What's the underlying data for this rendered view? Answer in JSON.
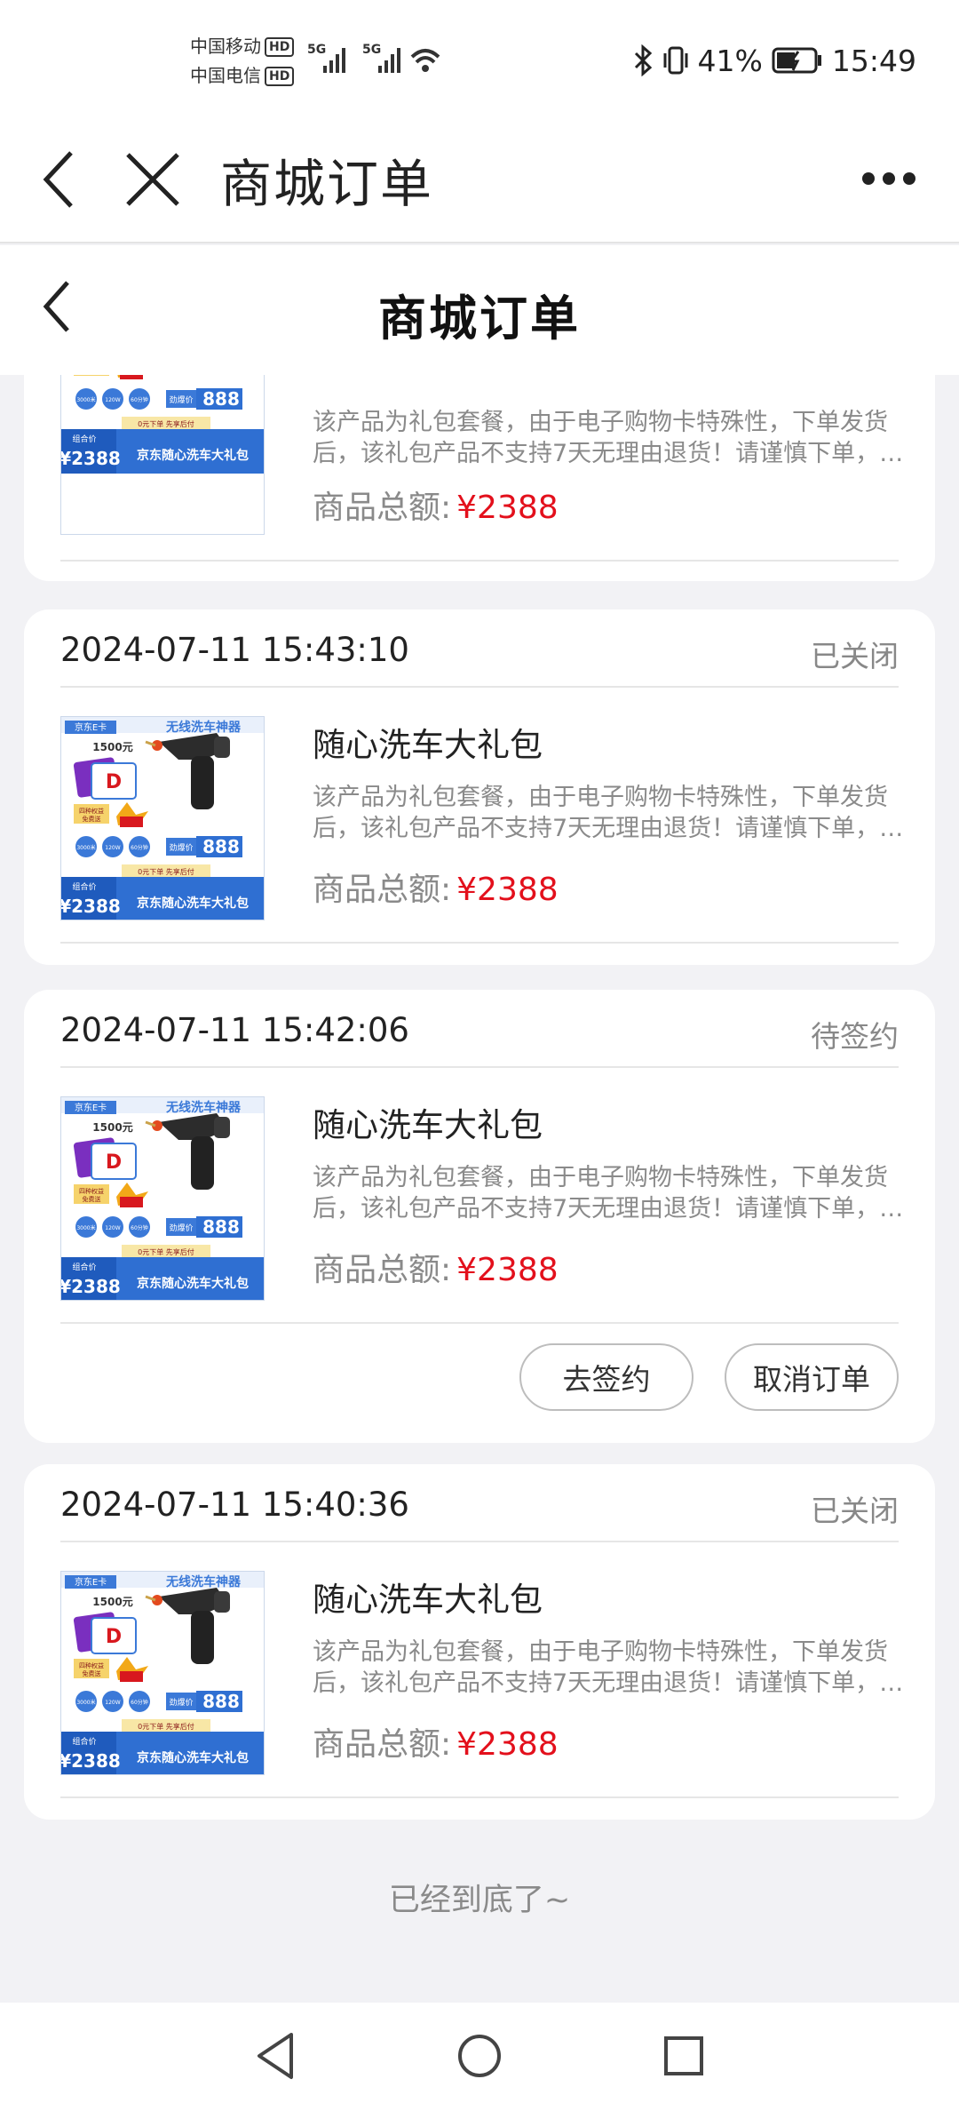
{
  "status_bar": {
    "carrier1": "中国移动",
    "carrier2": "中国电信",
    "hd": "HD",
    "net1": "5G",
    "net2": "5G",
    "battery": "41%",
    "time": "15:49"
  },
  "web_header": {
    "title": "商城订单",
    "back_icon": "chevron-left-icon",
    "close_icon": "close-icon",
    "more_icon": "more-dots-icon"
  },
  "page_header": {
    "title": "商城订单",
    "back_icon": "chevron-left-icon"
  },
  "thumbnail": {
    "top_left_label": "京东E卡",
    "top_right_label": "无线洗车神器",
    "amount": "1500元",
    "badge_left": "四种权益",
    "badge_left_sub": "免费送",
    "circle1": "3000米",
    "circle2": "120W",
    "circle3": "60分钟",
    "hot_label": "劲爆价",
    "hot_price": "888",
    "zero_down": "0元下单 先享后付",
    "combo_label": "组合价",
    "combo_price": "¥2388",
    "bottom_title": "京东随心洗车大礼包",
    "brand_blue": "#3b79d8",
    "bottom_bar": "#2f6fd2"
  },
  "orders": [
    {
      "time": "",
      "status": "",
      "product_name": "",
      "description": "该产品为礼包套餐，由于电子购物卡特殊性，下单发货后，该礼包产品不支持7天无理由退货！请谨慎下单，以免影响您的权益。",
      "total_label": "商品总额:",
      "price": "¥2388",
      "actions": []
    },
    {
      "time": "2024-07-11 15:43:10",
      "status": "已关闭",
      "product_name": "随心洗车大礼包",
      "description": "该产品为礼包套餐，由于电子购物卡特殊性，下单发货后，该礼包产品不支持7天无理由退货！请谨慎下单，以免影响您的权益。",
      "total_label": "商品总额:",
      "price": "¥2388",
      "actions": []
    },
    {
      "time": "2024-07-11 15:42:06",
      "status": "待签约",
      "product_name": "随心洗车大礼包",
      "description": "该产品为礼包套餐，由于电子购物卡特殊性，下单发货后，该礼包产品不支持7天无理由退货！请谨慎下单，以免影响您的权益。",
      "total_label": "商品总额:",
      "price": "¥2388",
      "actions": [
        "去签约",
        "取消订单"
      ]
    },
    {
      "time": "2024-07-11 15:40:36",
      "status": "已关闭",
      "product_name": "随心洗车大礼包",
      "description": "该产品为礼包套餐，由于电子购物卡特殊性，下单发货后，该礼包产品不支持7天无理由退货！请谨慎下单，以免影响您的权益。",
      "total_label": "商品总额:",
      "price": "¥2388",
      "actions": []
    }
  ],
  "end_note": "已经到底了~",
  "colors": {
    "price_red": "#e3101c",
    "muted": "#8a8a8a",
    "page_bg": "#f2f2f5"
  },
  "nav_bar": {
    "back_icon": "triangle-back-icon",
    "home_icon": "circle-home-icon",
    "recents_icon": "square-recents-icon"
  }
}
